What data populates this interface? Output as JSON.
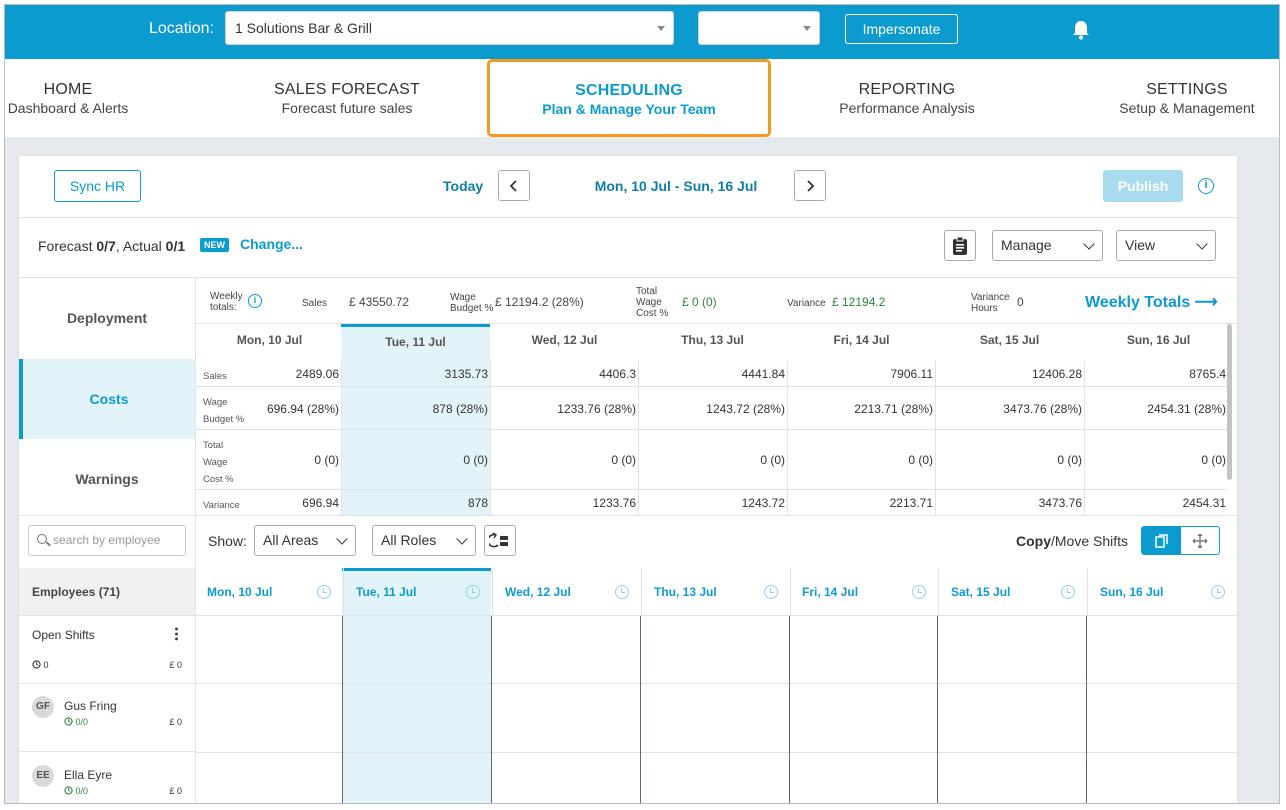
{
  "topbar": {
    "location_label": "Location:",
    "location_value": "1 Solutions Bar & Grill",
    "second_select_value": "",
    "impersonate_label": "Impersonate",
    "bell_icon": "bell-icon"
  },
  "nav": [
    {
      "title": "HOME",
      "subtitle": "Dashboard & Alerts"
    },
    {
      "title": "SALES FORECAST",
      "subtitle": "Forecast future sales"
    },
    {
      "title": "SCHEDULING",
      "subtitle": "Plan & Manage Your Team",
      "active": true
    },
    {
      "title": "REPORTING",
      "subtitle": "Performance Analysis"
    },
    {
      "title": "SETTINGS",
      "subtitle": "Setup & Management"
    }
  ],
  "toolbar": {
    "sync_label": "Sync HR",
    "today_label": "Today",
    "date_range": "Mon, 10 Jul - Sun, 16 Jul",
    "publish_label": "Publish",
    "prev_icon": "chevron-left-icon",
    "next_icon": "chevron-right-icon"
  },
  "forecast": {
    "forecast_label": "Forecast",
    "forecast_value": "0/7",
    "actual_label": "Actual",
    "actual_value": "0/1",
    "new_badge": "NEW",
    "change_label": "Change...",
    "manage_label": "Manage",
    "view_label": "View"
  },
  "side_tabs": [
    "Deployment",
    "Costs",
    "Warnings"
  ],
  "summary": {
    "weekly_label": "Weekly totals:",
    "sales_label": "Sales",
    "sales_value": "£ 43550.72",
    "wage_budget_label": "Wage Budget %",
    "wage_budget_value": "£ 12194.2 (28%)",
    "total_wage_label": "Total Wage Cost %",
    "total_wage_value": "£ 0 (0)",
    "variance_label": "Variance",
    "variance_value": "£ 12194.2",
    "variance_hours_label": "Variance Hours",
    "variance_hours_value": "0",
    "weekly_totals_link": "Weekly Totals ⟶"
  },
  "days": [
    "Mon, 10 Jul",
    "Tue, 11 Jul",
    "Wed, 12 Jul",
    "Thu, 13 Jul",
    "Fri, 14 Jul",
    "Sat, 15 Jul",
    "Sun, 16 Jul"
  ],
  "row_labels": {
    "sales": "Sales",
    "wage_budget": "Wage Budget %",
    "total_wage": "Total Wage Cost %",
    "variance": "Variance"
  },
  "costs": {
    "sales": [
      "2489.06",
      "3135.73",
      "4406.3",
      "4441.84",
      "7906.11",
      "12406.28",
      "8765.4"
    ],
    "wage_budget": [
      "696.94 (28%)",
      "878 (28%)",
      "1233.76 (28%)",
      "1243.72 (28%)",
      "2213.71 (28%)",
      "3473.76 (28%)",
      "2454.31 (28%)"
    ],
    "total_wage": [
      "0 (0)",
      "0 (0)",
      "0 (0)",
      "0 (0)",
      "0 (0)",
      "0 (0)",
      "0 (0)"
    ],
    "variance": [
      "696.94",
      "878",
      "1233.76",
      "1243.72",
      "2213.71",
      "3473.76",
      "2454.31"
    ]
  },
  "filters": {
    "search_placeholder": "search by employee",
    "show_label": "Show:",
    "areas_value": "All Areas",
    "roles_value": "All Roles",
    "copy_label": "Copy",
    "move_label": "/Move Shifts"
  },
  "employees": {
    "header": "Employees (71)",
    "open_shifts": {
      "label": "Open Shifts",
      "hours": "0",
      "cost": "£ 0"
    },
    "rows": [
      {
        "initials": "GF",
        "name": "Gus Fring",
        "hours": "0/0",
        "cost": "£ 0"
      },
      {
        "initials": "EE",
        "name": "Ella Eyre",
        "hours": "0/0",
        "cost": "£ 0"
      }
    ]
  },
  "colors": {
    "brand": "#0c9bcf",
    "highlight": "#f29a1f",
    "positive": "#2e8540"
  }
}
